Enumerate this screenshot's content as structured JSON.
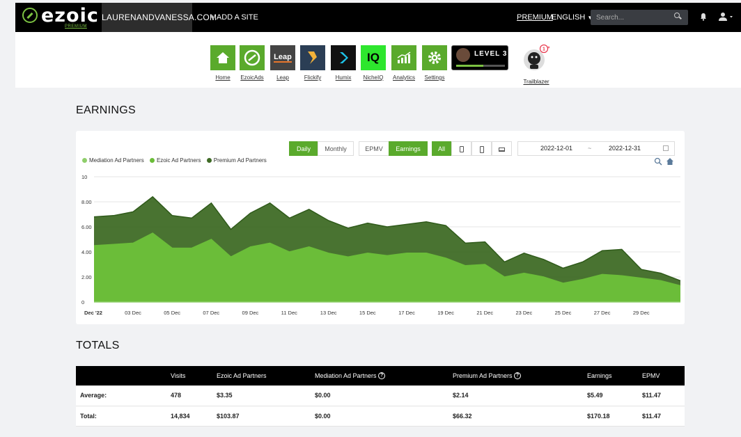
{
  "header": {
    "brand": "ezoic",
    "brand_sub": "PREMIUM",
    "site": "LAURENANDVANESSA.COM",
    "add_site": "+ ADD A SITE",
    "premium": "PREMIUM",
    "language": "ENGLISH",
    "search_placeholder": "Search..."
  },
  "apps": [
    {
      "label": "Home",
      "icon": "home-icon",
      "color": "#5aaa2c"
    },
    {
      "label": "EzoicAds",
      "icon": "ezoic-ads-icon",
      "color": "#5aaa2c"
    },
    {
      "label": "Leap",
      "icon": "leap-icon",
      "color": "#444444",
      "tile_text": "Leap"
    },
    {
      "label": "Flickify",
      "icon": "flickify-icon",
      "color": "#2b3e55"
    },
    {
      "label": "Humix",
      "icon": "humix-icon",
      "color": "#111111"
    },
    {
      "label": "NicheIQ",
      "icon": "nicheiq-icon",
      "color": "#2ee62e",
      "tile_text": "IQ"
    },
    {
      "label": "Analytics",
      "icon": "analytics-icon",
      "color": "#5aaa2c"
    },
    {
      "label": "Settings",
      "icon": "settings-icon",
      "color": "#5aaa2c"
    }
  ],
  "level": {
    "text": "LEVEL 3",
    "progress": 0.55
  },
  "trailblazer": {
    "label": "Trailblazer",
    "badge": "1"
  },
  "earnings": {
    "title": "EARNINGS",
    "periods": [
      "Daily",
      "Monthly"
    ],
    "metrics": [
      "EPMV",
      "Earnings"
    ],
    "devices": [
      "All"
    ],
    "date_start": "2022-12-01",
    "date_sep": "~",
    "date_end": "2022-12-31"
  },
  "chart_data": {
    "type": "area",
    "stacked": true,
    "legend": [
      "Mediation Ad Partners",
      "Ezoic Ad Partners",
      "Premium Ad Partners"
    ],
    "legend_position": "top-left",
    "colors": {
      "Mediation Ad Partners": "#8fce6b",
      "Ezoic Ad Partners": "#6bbd39",
      "Premium Ad Partners": "#3f6b26"
    },
    "y_ticks": [
      "0",
      "2.00",
      "4.00",
      "6.00",
      "8.00",
      "10"
    ],
    "ylim": [
      0,
      10
    ],
    "x_ticks": [
      "Dec '22",
      "03 Dec",
      "05 Dec",
      "07 Dec",
      "09 Dec",
      "11 Dec",
      "13 Dec",
      "15 Dec",
      "17 Dec",
      "19 Dec",
      "21 Dec",
      "23 Dec",
      "25 Dec",
      "27 Dec",
      "29 Dec"
    ],
    "x": [
      "2022-12-01",
      "2022-12-02",
      "2022-12-03",
      "2022-12-04",
      "2022-12-05",
      "2022-12-06",
      "2022-12-07",
      "2022-12-08",
      "2022-12-09",
      "2022-12-10",
      "2022-12-11",
      "2022-12-12",
      "2022-12-13",
      "2022-12-14",
      "2022-12-15",
      "2022-12-16",
      "2022-12-17",
      "2022-12-18",
      "2022-12-19",
      "2022-12-20",
      "2022-12-21",
      "2022-12-22",
      "2022-12-23",
      "2022-12-24",
      "2022-12-25",
      "2022-12-26",
      "2022-12-27",
      "2022-12-28",
      "2022-12-29",
      "2022-12-30",
      "2022-12-31"
    ],
    "series": [
      {
        "name": "Mediation Ad Partners",
        "values": [
          0,
          0,
          0,
          0,
          0,
          0,
          0,
          0,
          0,
          0,
          0,
          0,
          0,
          0,
          0,
          0,
          0,
          0,
          0,
          0,
          0,
          0,
          0,
          0,
          0,
          0,
          0,
          0,
          0,
          0,
          0
        ]
      },
      {
        "name": "Ezoic Ad Partners",
        "values": [
          4.5,
          4.6,
          4.7,
          5.5,
          4.3,
          4.3,
          5.0,
          3.6,
          4.4,
          4.7,
          4.0,
          4.4,
          3.9,
          3.6,
          3.9,
          3.7,
          3.9,
          3.9,
          3.5,
          2.9,
          3.0,
          2.0,
          2.3,
          2.0,
          1.5,
          1.8,
          2.2,
          2.1,
          1.9,
          1.7,
          1.3
        ]
      },
      {
        "name": "Premium Ad Partners",
        "values": [
          2.3,
          2.3,
          2.5,
          2.9,
          2.6,
          2.4,
          2.9,
          2.2,
          2.7,
          3.2,
          2.7,
          3.0,
          2.6,
          2.3,
          2.4,
          2.3,
          2.3,
          2.5,
          2.6,
          1.8,
          1.8,
          1.2,
          1.6,
          1.4,
          1.2,
          1.4,
          1.9,
          2.1,
          0.7,
          0.6,
          0.4
        ]
      }
    ]
  },
  "totals": {
    "title": "TOTALS",
    "columns": [
      "",
      "Visits",
      "Ezoic Ad Partners",
      "Mediation Ad Partners",
      "Premium Ad Partners",
      "Earnings",
      "EPMV"
    ],
    "rows": [
      [
        "Average:",
        "478",
        "$3.35",
        "$0.00",
        "$2.14",
        "$5.49",
        "$11.47"
      ],
      [
        "Total:",
        "14,834",
        "$103.87",
        "$0.00",
        "$66.32",
        "$170.18",
        "$11.47"
      ]
    ]
  }
}
